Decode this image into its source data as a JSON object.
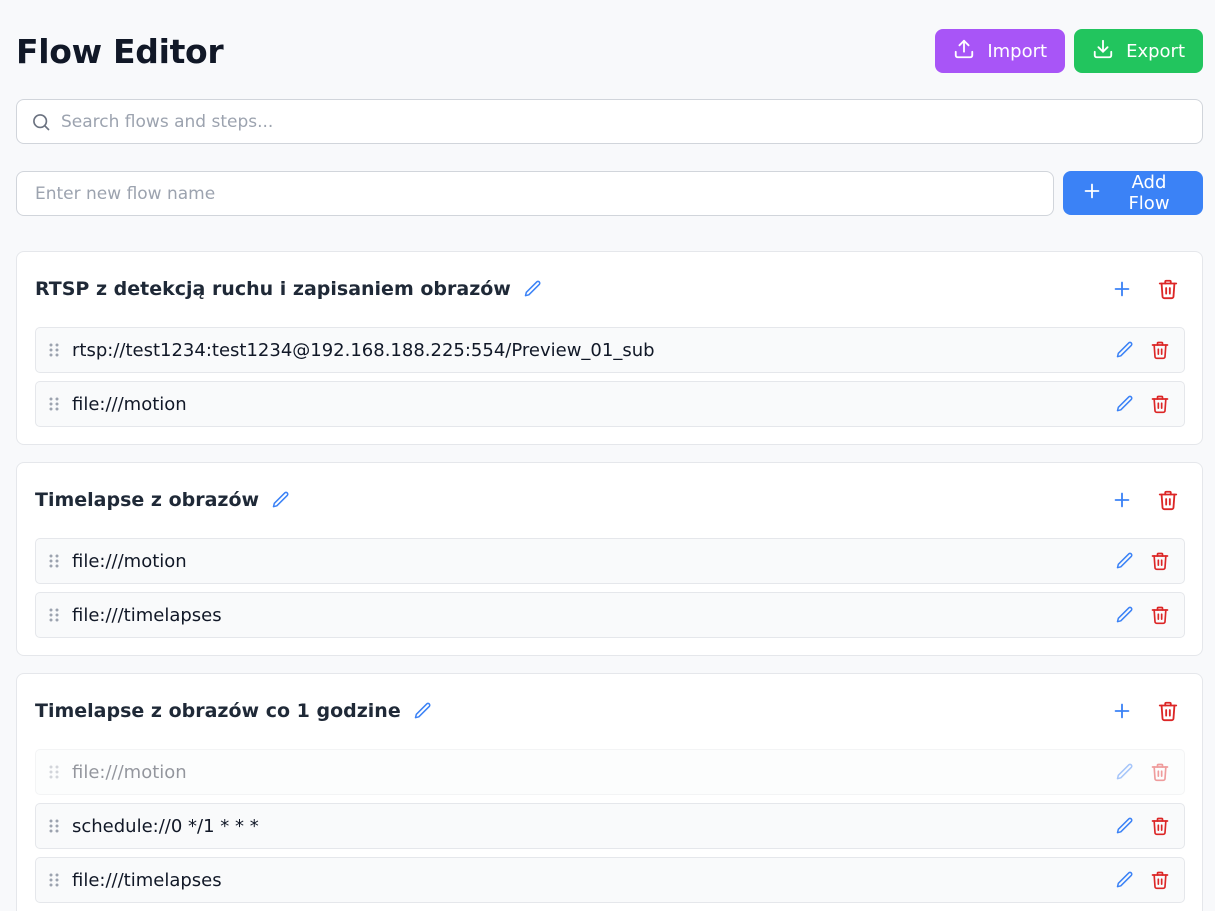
{
  "app": {
    "title": "Flow Editor",
    "import_label": "Import",
    "export_label": "Export"
  },
  "search": {
    "placeholder": "Search flows and steps..."
  },
  "new_flow": {
    "placeholder": "Enter new flow name",
    "add_label": "Add Flow"
  },
  "colors": {
    "import": "#a855f7",
    "export": "#22c55e",
    "primary": "#3b82f6",
    "danger": "#dc2626"
  },
  "flows": [
    {
      "name": "RTSP z detekcją ruchu i zapisaniem obrazów",
      "steps": [
        {
          "text": "rtsp://test1234:test1234@192.168.188.225:554/Preview_01_sub"
        },
        {
          "text": "file:///motion"
        }
      ]
    },
    {
      "name": "Timelapse z obrazów",
      "steps": [
        {
          "text": "file:///motion"
        },
        {
          "text": "file:///timelapses"
        }
      ]
    },
    {
      "name": "Timelapse z obrazów co 1 godzine",
      "steps": [
        {
          "text": "file:///motion",
          "dragging": true
        },
        {
          "text": "schedule://0 */1 * * *"
        },
        {
          "text": "file:///timelapses"
        }
      ]
    }
  ]
}
